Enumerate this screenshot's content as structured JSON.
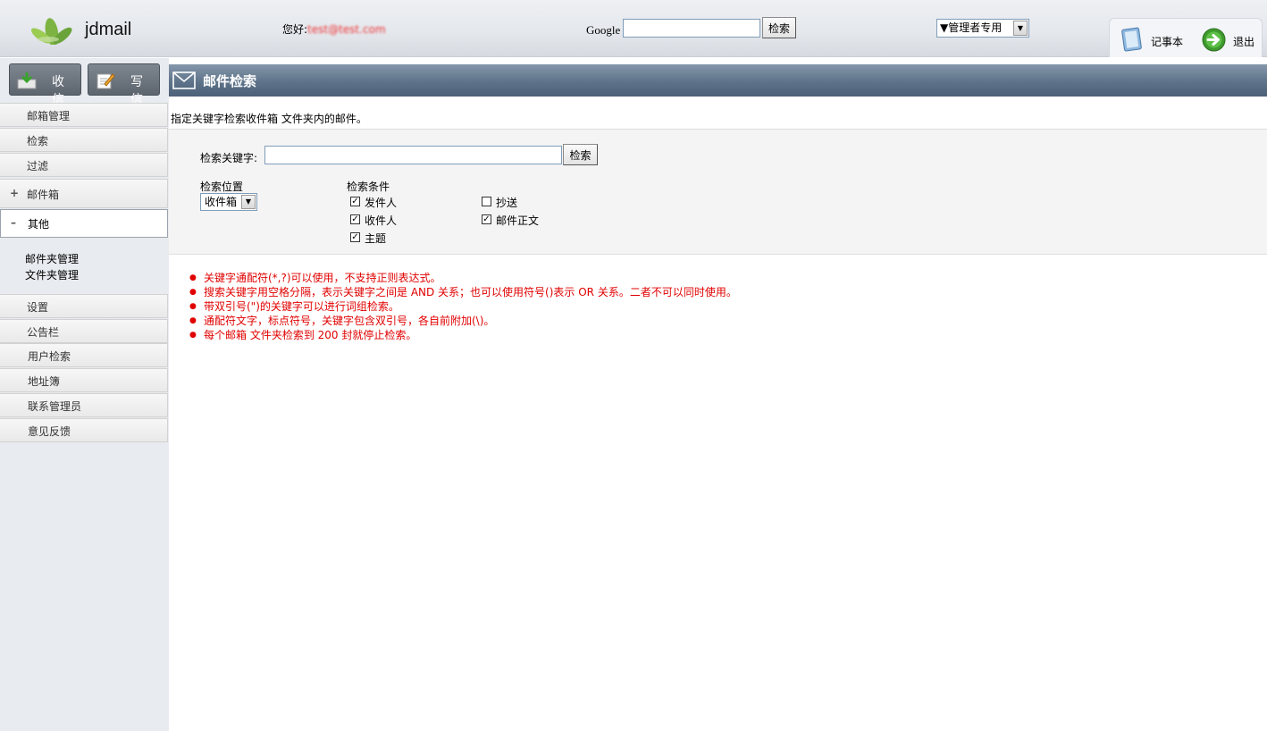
{
  "header": {
    "logo_text": "jdmail",
    "greeting_label": "您好:",
    "greeting_user": "test@test.com",
    "google_label": "Google",
    "google_search_button": "检索",
    "admin_select_value": "▼管理者专用",
    "notepad_label": "记事本",
    "logout_label": "退出"
  },
  "sidebar": {
    "inbox_button": "收 信",
    "compose_button": "写 信",
    "items": [
      {
        "label": "邮箱管理"
      },
      {
        "label": "检索"
      },
      {
        "label": "过滤"
      },
      {
        "label": "邮件箱",
        "prefix": "+"
      },
      {
        "label": "其他",
        "prefix": "–"
      }
    ],
    "sub_items": [
      "邮件夹管理",
      "文件夹管理"
    ],
    "bottom_items": [
      "设置",
      "公告栏",
      "用户检索",
      "地址簿",
      "联系管理员",
      "意见反馈"
    ]
  },
  "main": {
    "title": "邮件检索",
    "description": "指定关键字检索收件箱 文件夹内的邮件。",
    "keyword_label": "检索关键字:",
    "keyword_value": "",
    "search_button": "检索",
    "location_label": "检索位置",
    "location_value": "收件箱",
    "conditions_label": "检索条件",
    "conditions": [
      {
        "label": "发件人",
        "checked": true
      },
      {
        "label": "收件人",
        "checked": true
      },
      {
        "label": "主题",
        "checked": true
      },
      {
        "label": "抄送",
        "checked": false
      },
      {
        "label": "邮件正文",
        "checked": true
      }
    ],
    "notes": [
      "关键字通配符(*,?)可以使用，不支持正则表达式。",
      "搜索关键字用空格分隔，表示关键字之间是  AND 关系；也可以使用符号()表示  OR 关系。二者不可以同时使用。",
      "带双引号(\")的关键字可以进行词组检索。",
      "通配符文字，标点符号，关键字包含双引号，各自前附加(\\)。",
      "每个邮箱 文件夹检索到  200 封就停止检索。"
    ]
  },
  "colors": {
    "title_bar": "#5e7389",
    "notes_text": "#e00000",
    "sidebar_bg": "#e8ebef"
  }
}
